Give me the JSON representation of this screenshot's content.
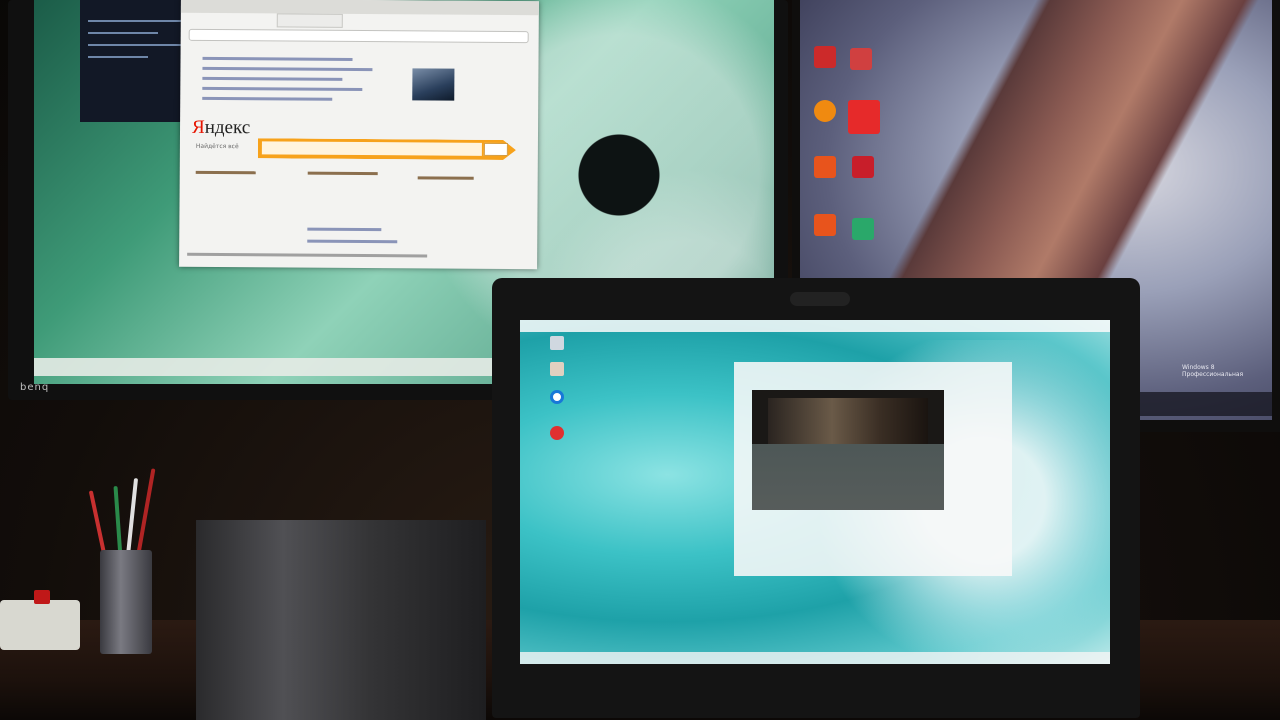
{
  "scene": {
    "brand_label": "benq",
    "left_monitor": {
      "browser": {
        "logo_first_letter": "Я",
        "logo_rest": "ндекс",
        "tagline": "Найдётся всё"
      }
    },
    "right_monitor": {
      "watermark": "Windows 8 Профессиональная"
    }
  },
  "colors": {
    "yandex_red": "#e61400",
    "yandex_orange": "#f7a21b",
    "laptop_teal": "#3cc2c6"
  }
}
